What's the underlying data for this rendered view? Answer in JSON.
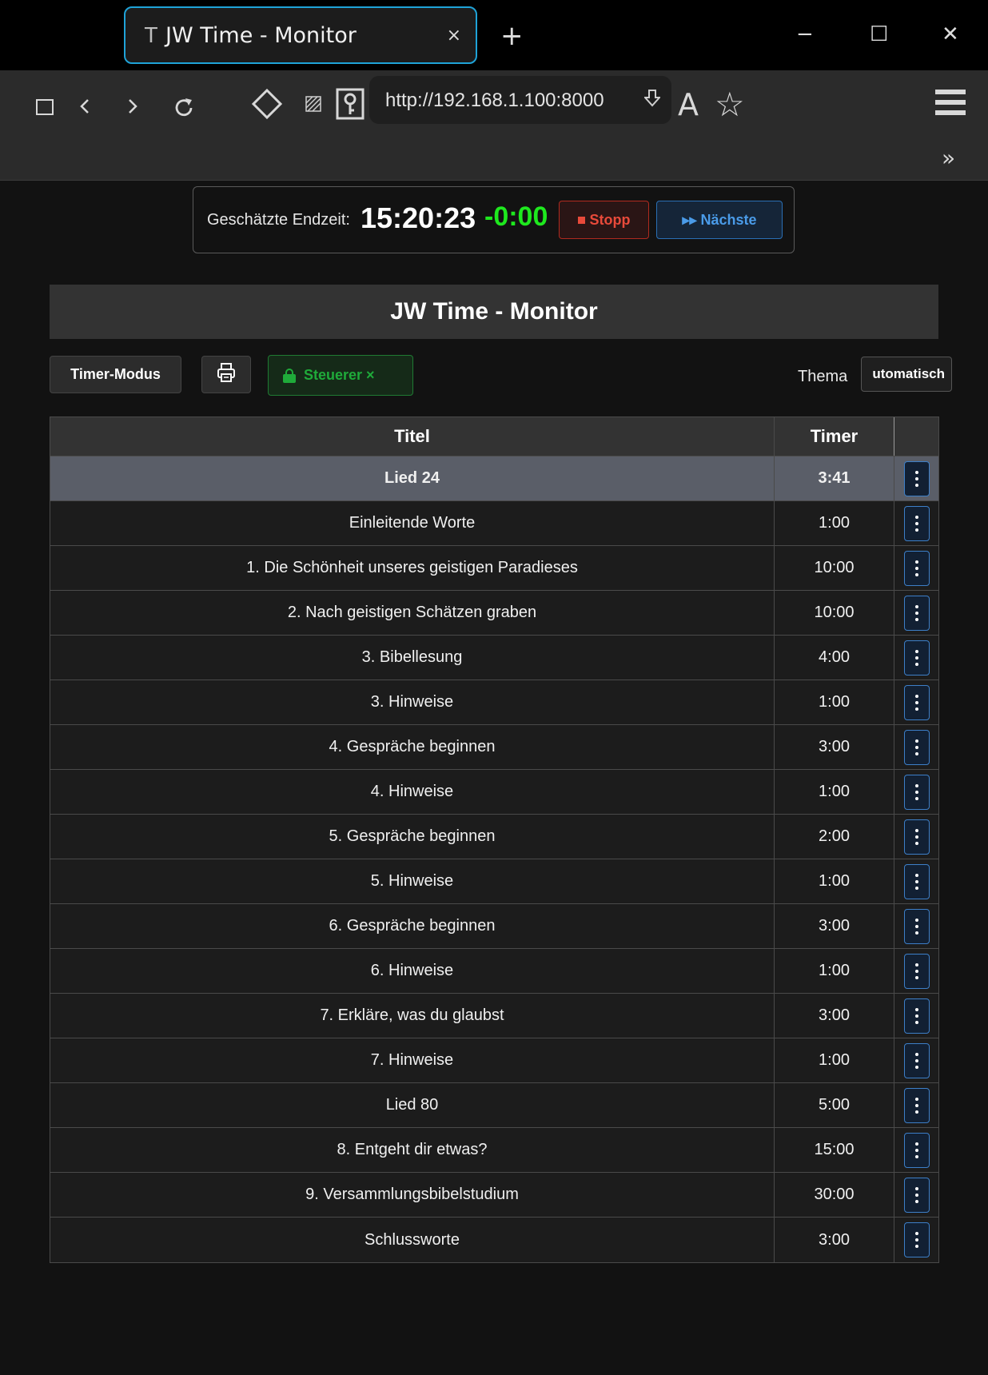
{
  "browser": {
    "tab_favicon": "T",
    "tab_title": "JW Time - Monitor",
    "tab_close": "×",
    "new_tab": "+",
    "window_minimize": "−",
    "window_maximize": "☐",
    "window_close": "✕",
    "url": "http://192.168.1.100:8000",
    "reader_mode": "A",
    "bookmark": "☆",
    "menu": "≡",
    "overflow": "»",
    "tab_border_color": "#1fa3d8"
  },
  "status": {
    "label": "Geschätzte Endzeit:",
    "end_time": "15:20:23",
    "difference": "-0:00",
    "difference_color": "#1ee81e",
    "stop_label": "Stopp",
    "next_label": "▸▸ Nächste"
  },
  "page": {
    "title": "JW Time - Monitor"
  },
  "controls": {
    "timer_mode_label": "Timer-Modus",
    "print_icon": "printer-icon",
    "steuerer_label": "Steuerer ×",
    "theme_label": "Thema",
    "theme_value": "utomatisch"
  },
  "table": {
    "headers": {
      "title": "Titel",
      "timer": "Timer"
    },
    "rows": [
      {
        "title": "Lied 24",
        "timer": "3:41",
        "active": true
      },
      {
        "title": "Einleitende Worte",
        "timer": "1:00"
      },
      {
        "title": "1. Die Schönheit unseres geistigen Paradieses",
        "timer": "10:00"
      },
      {
        "title": "2. Nach geistigen Schätzen graben",
        "timer": "10:00"
      },
      {
        "title": "3. Bibellesung",
        "timer": "4:00"
      },
      {
        "title": "3. Hinweise",
        "timer": "1:00"
      },
      {
        "title": "4. Gespräche beginnen",
        "timer": "3:00"
      },
      {
        "title": "4. Hinweise",
        "timer": "1:00"
      },
      {
        "title": "5. Gespräche beginnen",
        "timer": "2:00"
      },
      {
        "title": "5. Hinweise",
        "timer": "1:00"
      },
      {
        "title": "6. Gespräche beginnen",
        "timer": "3:00"
      },
      {
        "title": "6. Hinweise",
        "timer": "1:00"
      },
      {
        "title": "7. Erkläre, was du glaubst",
        "timer": "3:00"
      },
      {
        "title": "7. Hinweise",
        "timer": "1:00"
      },
      {
        "title": "Lied 80",
        "timer": "5:00"
      },
      {
        "title": "8. Entgeht dir etwas?",
        "timer": "15:00"
      },
      {
        "title": "9. Versammlungsbibelstudium",
        "timer": "30:00"
      },
      {
        "title": "Schlussworte",
        "timer": "3:00"
      }
    ]
  }
}
